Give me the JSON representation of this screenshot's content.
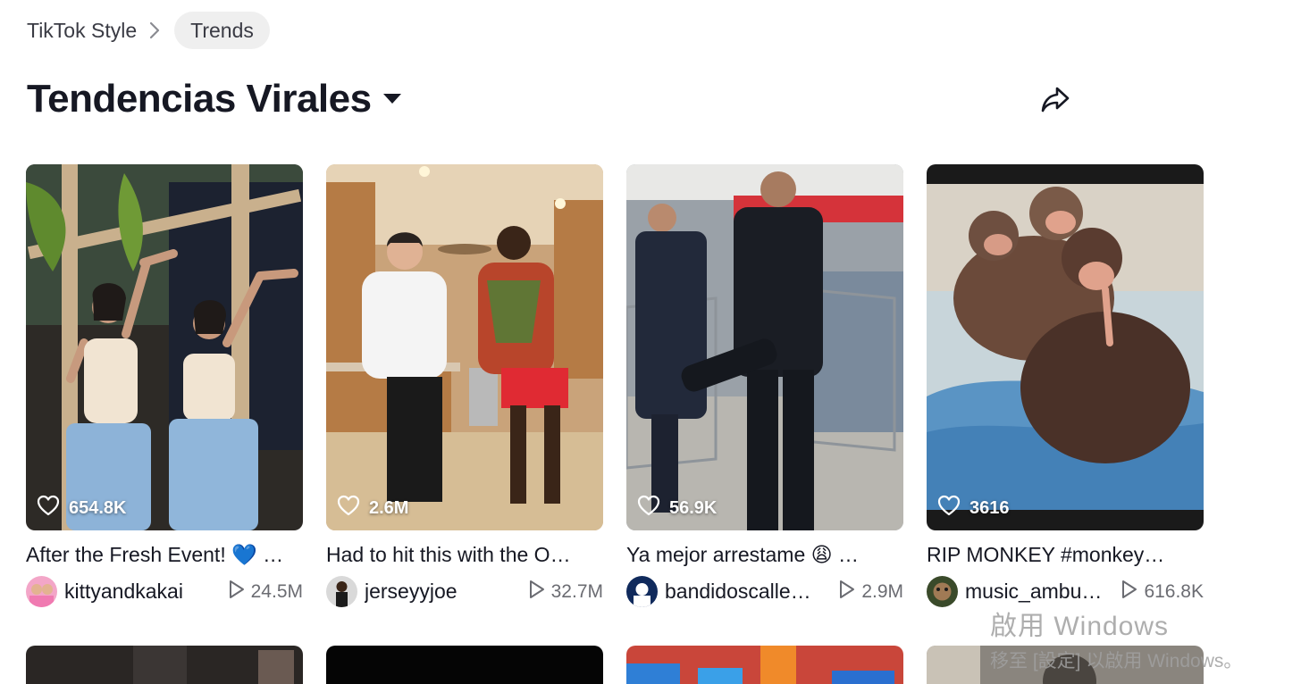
{
  "breadcrumb": {
    "parent_label": "TikTok Style",
    "current_label": "Trends"
  },
  "header": {
    "title": "Tendencias Virales"
  },
  "cards": [
    {
      "likes": "654.8K",
      "caption": "After the Fresh Event! 💙 …",
      "author": "kittyandkakai",
      "views": "24.5M"
    },
    {
      "likes": "2.6M",
      "caption": "Had to hit this with the O…",
      "author": "jerseyyjoe",
      "views": "32.7M"
    },
    {
      "likes": "56.9K",
      "caption": "Ya mejor arrestame 😩 …",
      "author": "bandidoscalle…",
      "views": "2.9M"
    },
    {
      "likes": "3616",
      "caption": "RIP MONKEY #monkey…",
      "author": "music_ambu…",
      "views": "616.8K"
    }
  ],
  "watermark": {
    "line1": "啟用 Windows",
    "line2": "移至 [設定] 以啟用 Windows。"
  },
  "colors": {
    "text_primary": "#161823",
    "text_secondary": "#6b6c72",
    "pill_bg": "#efefef"
  }
}
